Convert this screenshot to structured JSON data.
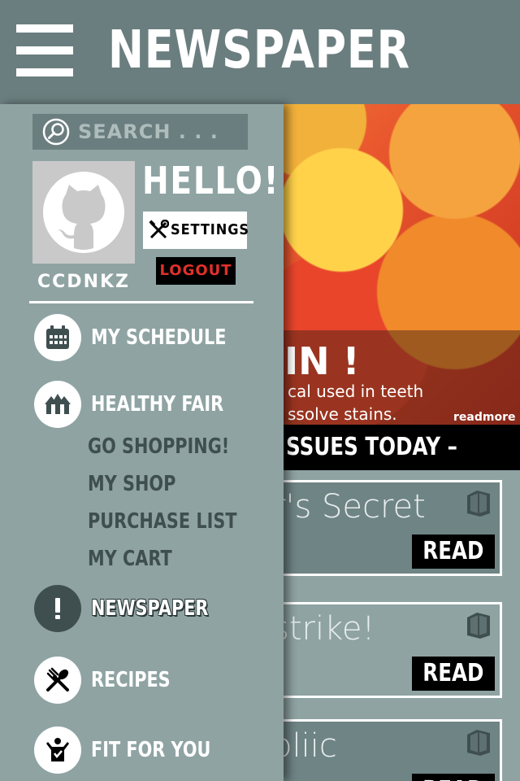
{
  "header": {
    "title": "NEWSPAPER",
    "menu_icon": "hamburger-icon"
  },
  "drawer": {
    "search": {
      "placeholder": "SEARCH . . ."
    },
    "profile": {
      "greeting": "HELLO!",
      "username": "CCDNKZ",
      "settings_label": "SETTINGS",
      "logout_label": "LOGOUT"
    },
    "nav": [
      {
        "label": "MY SCHEDULE",
        "icon": "calendar-icon"
      },
      {
        "label": "HEALTHY FAIR",
        "icon": "tent-icon",
        "subitems": [
          "GO SHOPPING!",
          "MY SHOP",
          "PURCHASE LIST",
          "MY CART"
        ]
      },
      {
        "label": "NEWSPAPER",
        "icon": "exclamation-icon",
        "active": true
      },
      {
        "label": "RECIPES",
        "icon": "utensils-icon"
      },
      {
        "label": "FIT FOR YOU",
        "icon": "person-icon"
      }
    ]
  },
  "main": {
    "hero": {
      "headline": "IN !",
      "line1": "cal used in teeth",
      "line2": "ssolve stains.",
      "readmore": "readmore ››"
    },
    "issues_heading": "SSUES TODAY –",
    "issues": [
      {
        "title": "r's Secret",
        "read_label": "READ"
      },
      {
        "title": "strike!",
        "read_label": "READ"
      },
      {
        "title": "oliic",
        "read_label": "READ"
      }
    ]
  },
  "colors": {
    "header_bg": "#6b7e7f",
    "drawer_bg": "#8fa3a3",
    "active_nav": "#3f4f50",
    "logout_text": "#e0302a"
  }
}
